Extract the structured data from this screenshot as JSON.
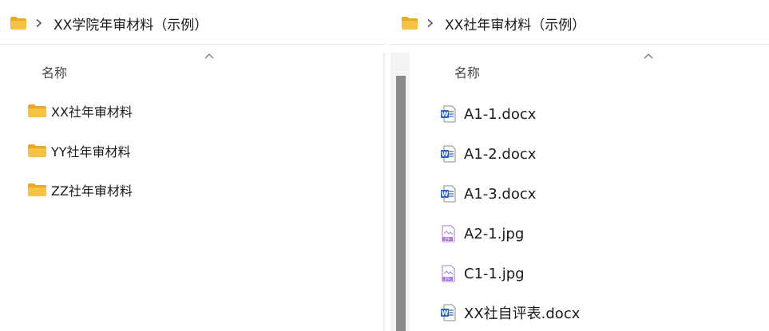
{
  "left": {
    "breadcrumb": {
      "folder_icon": "folder-icon",
      "separator": "chevron-right-icon",
      "path": "XX学院年审材料（示例）"
    },
    "column_header": "名称",
    "sort_indicator": "chevron-up-icon",
    "items": [
      {
        "name": "XX社年审材料",
        "icon": "folder-icon"
      },
      {
        "name": "YY社年审材料",
        "icon": "folder-icon"
      },
      {
        "name": "ZZ社年审材料",
        "icon": "folder-icon"
      }
    ]
  },
  "right": {
    "breadcrumb": {
      "folder_icon": "folder-icon",
      "separator": "chevron-right-icon",
      "path": "XX社年审材料（示例）"
    },
    "column_header": "名称",
    "sort_indicator": "chevron-up-icon",
    "items": [
      {
        "name": "A1-1.docx",
        "icon": "word-document-icon"
      },
      {
        "name": "A1-2.docx",
        "icon": "word-document-icon"
      },
      {
        "name": "A1-3.docx",
        "icon": "word-document-icon"
      },
      {
        "name": "A2-1.jpg",
        "icon": "jpg-image-icon"
      },
      {
        "name": "C1-1.jpg",
        "icon": "jpg-image-icon"
      },
      {
        "name": "XX社自评表.docx",
        "icon": "word-document-icon"
      }
    ]
  },
  "colors": {
    "folder": "#F5C243",
    "folder_dark": "#E8A923",
    "word_blue": "#2B63C6",
    "jpg_purple": "#A77BD3",
    "scroll_thumb": "#8A8A8A"
  }
}
